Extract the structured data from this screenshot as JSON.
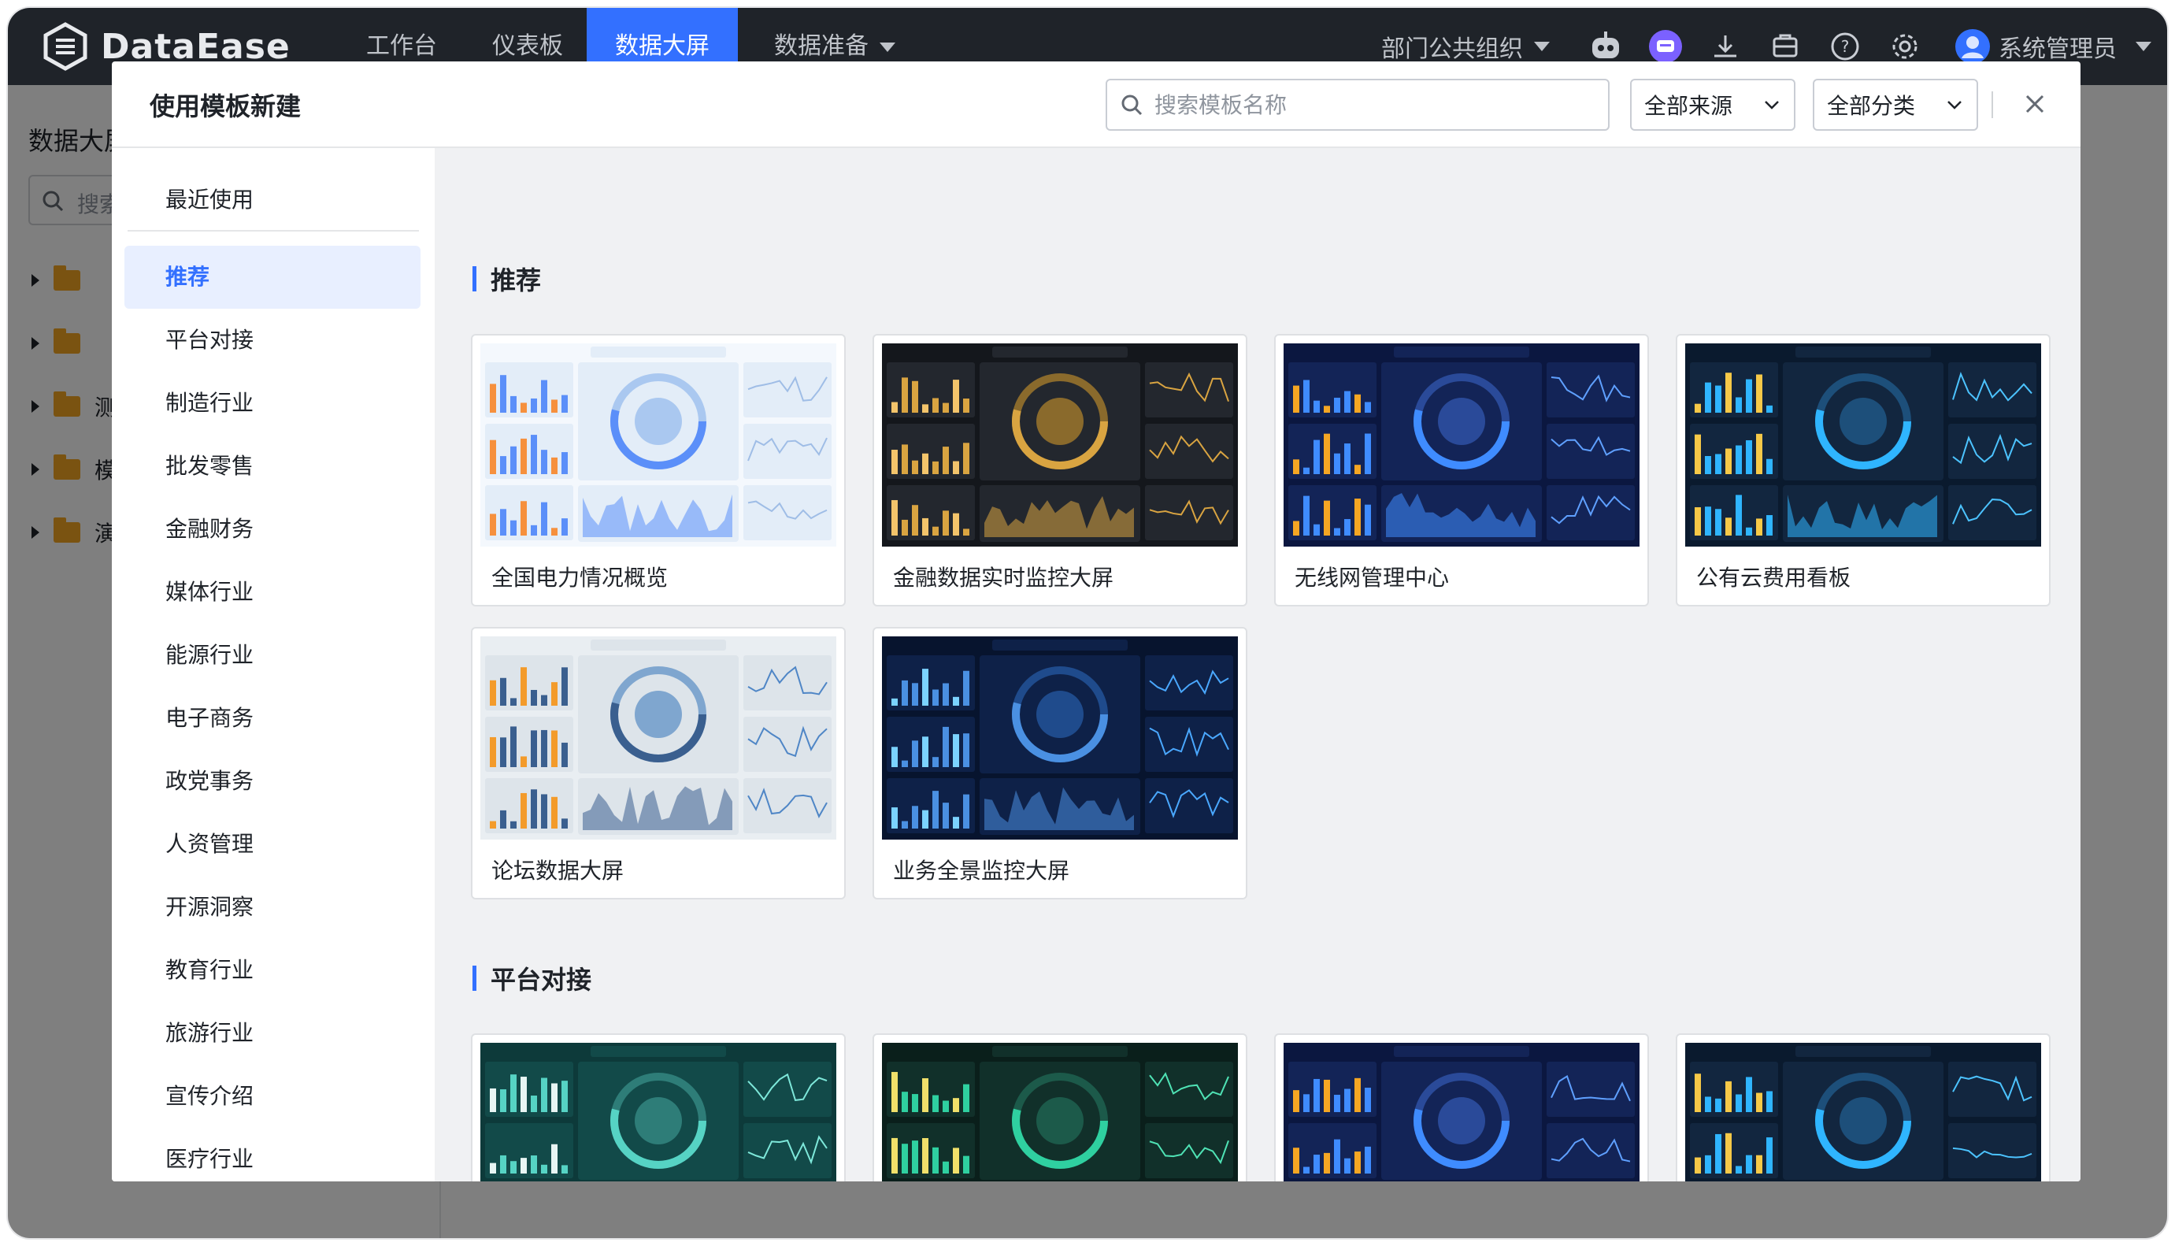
{
  "app": {
    "brand": "DataEase"
  },
  "nav": {
    "items": [
      "工作台",
      "仪表板",
      "数据大屏",
      "数据准备"
    ],
    "active_index": 2,
    "org": "部门公共组织",
    "user": "系统管理员"
  },
  "background": {
    "title": "数据大屏",
    "search_placeholder": "搜索",
    "tree": [
      {
        "label": ""
      },
      {
        "label": ""
      },
      {
        "label": "测"
      },
      {
        "label": "模"
      },
      {
        "label": "演"
      }
    ]
  },
  "modal": {
    "title": "使用模板新建",
    "search_placeholder": "搜索模板名称",
    "source_select": "全部来源",
    "category_select": "全部分类",
    "menu": [
      "最近使用",
      "推荐",
      "平台对接",
      "制造行业",
      "批发零售",
      "金融财务",
      "媒体行业",
      "能源行业",
      "电子商务",
      "政党事务",
      "人资管理",
      "开源洞察",
      "教育行业",
      "旅游行业",
      "宣传介绍",
      "医疗行业"
    ],
    "menu_active_index": 1,
    "sections": [
      {
        "title": "推荐",
        "templates": [
          {
            "name": "全国电力情况概览",
            "theme": "light"
          },
          {
            "name": "金融数据实时监控大屏",
            "theme": "gold"
          },
          {
            "name": "无线网管理中心",
            "theme": "navy"
          },
          {
            "name": "公有云费用看板",
            "theme": "cloud"
          },
          {
            "name": "论坛数据大屏",
            "theme": "forum"
          },
          {
            "name": "业务全景监控大屏",
            "theme": "map"
          }
        ]
      },
      {
        "title": "平台对接",
        "templates": [
          {
            "name": "",
            "theme": "teal"
          },
          {
            "name": "",
            "theme": "darkgreen"
          },
          {
            "name": "",
            "theme": "navy"
          },
          {
            "name": "",
            "theme": "cloud"
          }
        ]
      }
    ]
  },
  "colors": {
    "accent": "#3370ff",
    "nav_bg": "#1f2329",
    "menu_active_bg": "#e8efff"
  }
}
